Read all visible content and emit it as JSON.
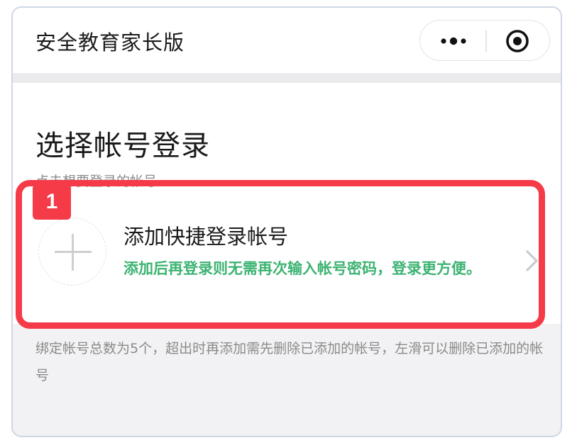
{
  "navbar": {
    "title": "安全教育家长版",
    "more_icon": "more-dots-icon",
    "close_icon": "record-close-icon"
  },
  "page": {
    "title": "选择帐号登录",
    "subtitle": "点击想要登录的帐号"
  },
  "add_account": {
    "title": "添加快捷登录帐号",
    "description": "添加后再登录则无需再次输入帐号密码，登录更方便。",
    "icon": "plus-icon",
    "chevron": "chevron-right-icon"
  },
  "footer": {
    "note": "绑定帐号总数为5个，超出时再添加需先删除已添加的帐号，左滑可以删除已添加的帐号"
  },
  "annotation": {
    "badge": "1",
    "color": "#f53a48"
  },
  "colors": {
    "accent_green": "#3cb371",
    "highlight_red": "#f53a48"
  }
}
